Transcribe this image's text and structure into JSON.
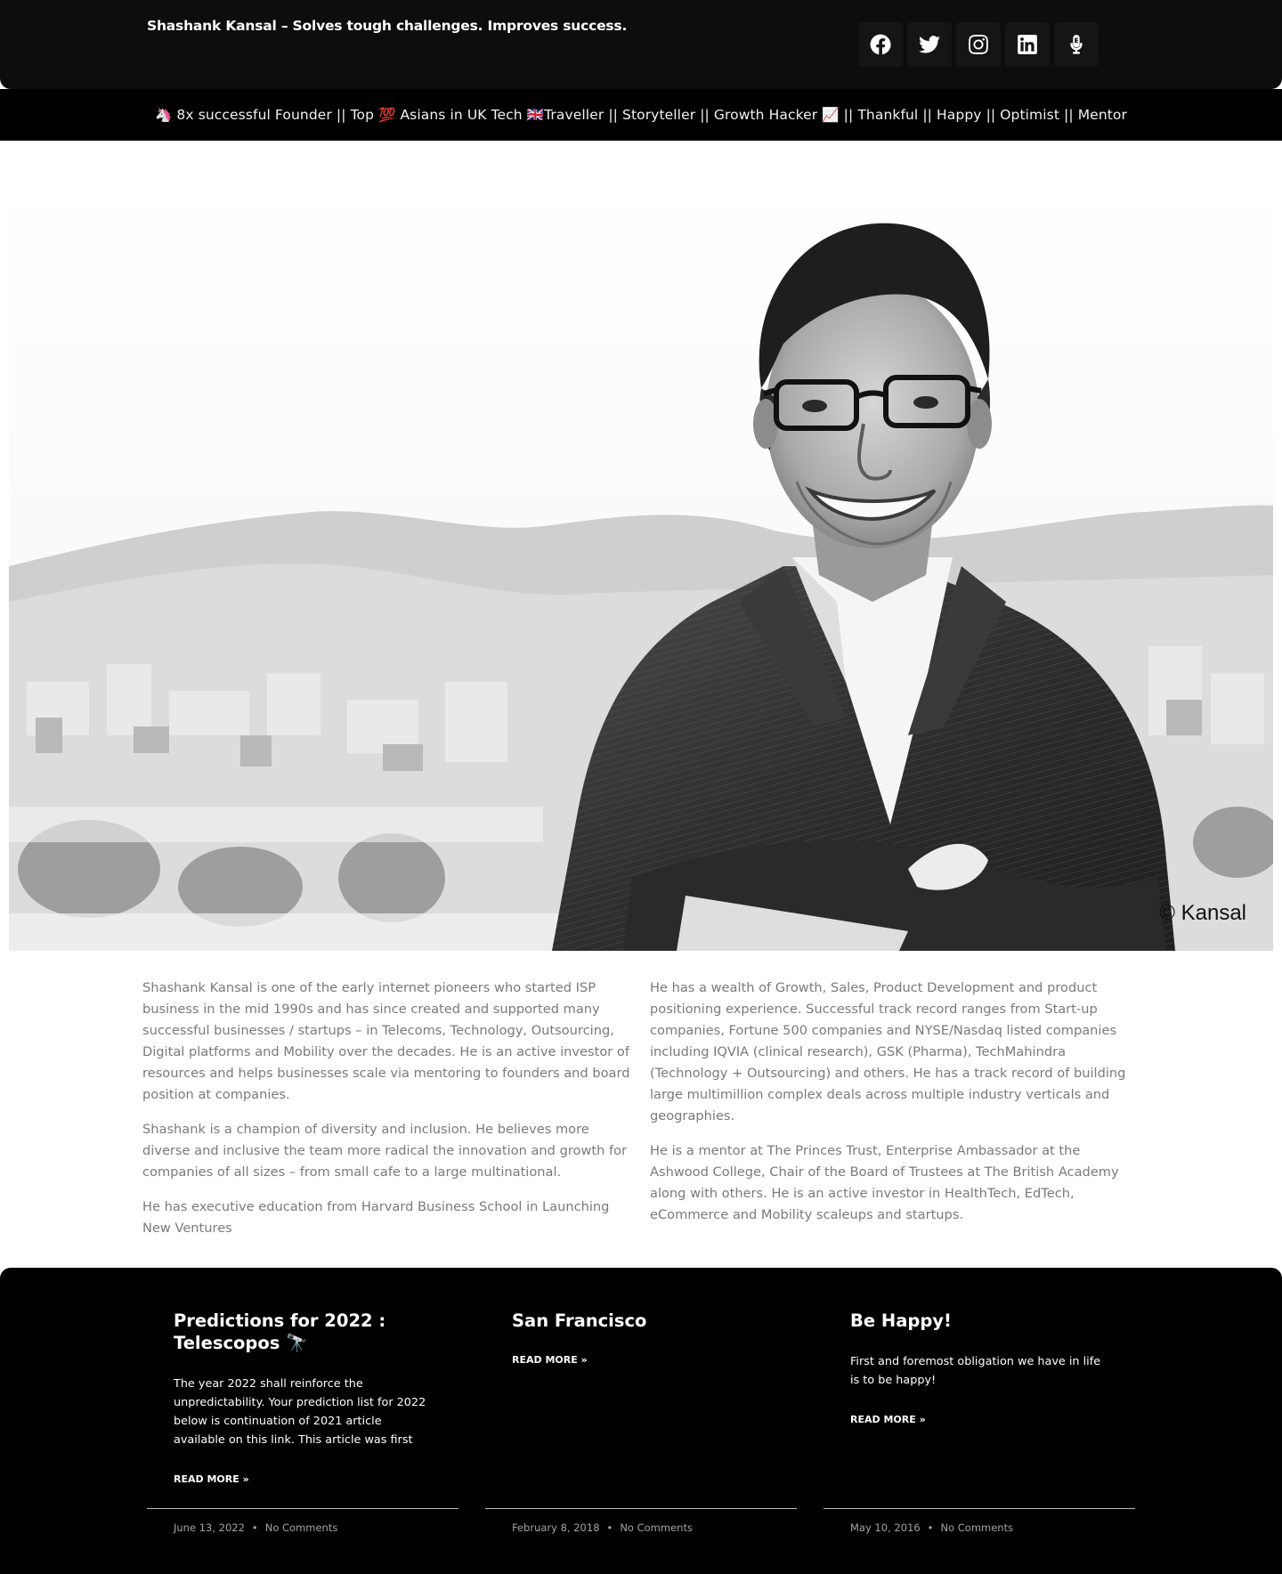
{
  "header": {
    "site_title": "Shashank Kansal – Solves tough challenges. Improves success.",
    "socials": [
      {
        "icon": "facebook-icon"
      },
      {
        "icon": "twitter-icon"
      },
      {
        "icon": "instagram-icon"
      },
      {
        "icon": "linkedin-icon"
      },
      {
        "icon": "microphone-icon"
      }
    ]
  },
  "tagline": "🦄 8x successful Founder || Top 💯 Asians in UK Tech 🇬🇧Traveller ||  Storyteller ||  Growth Hacker 📈 || Thankful  || Happy || Optimist || Mentor",
  "hero": {
    "copyright": "© Kansal"
  },
  "about": {
    "left": [
      "Shashank Kansal is one of the early internet pioneers who started ISP business in the mid 1990s and has since created and supported many successful businesses / startups – in Telecoms, Technology, Outsourcing, Digital platforms and Mobility over the decades. He is an active investor of resources and helps businesses scale via mentoring to founders and board position at companies.",
      "Shashank is a champion of diversity and inclusion. He believes more diverse and inclusive the team more radical the innovation and growth for companies of all sizes – from small cafe to a large multinational.",
      "He has executive education from Harvard Business School in Launching New Ventures"
    ],
    "right": [
      "He has a wealth of Growth, Sales, Product Development and product positioning experience. Successful track record ranges from Start-up companies, Fortune 500 companies and NYSE/Nasdaq listed companies including IQVIA (clinical research), GSK (Pharma), TechMahindra (Technology + Outsourcing) and others. He has a track record of building large multimillion complex deals across multiple industry verticals and geographies.",
      "He is a mentor at The Princes Trust, Enterprise Ambassador at the Ashwood College, Chair of the Board of Trustees at The British Academy along with others. He is an active investor in HealthTech, EdTech, eCommerce and Mobility scaleups and startups."
    ]
  },
  "posts": [
    {
      "title": "Predictions for 2022 : Telescopos 🔭",
      "excerpt": "The year 2022 shall reinforce the unpredictability. Your prediction list for 2022 below is continuation of 2021 article available on this link.  This article was first",
      "read_more": "READ MORE »",
      "date": "June 13, 2022",
      "comments": "No Comments"
    },
    {
      "title": "San Francisco",
      "excerpt": "",
      "read_more": "READ MORE »",
      "date": "February 8, 2018",
      "comments": "No Comments"
    },
    {
      "title": "Be Happy!",
      "excerpt": "First and foremost obligation we have in life is to be happy!",
      "read_more": "READ MORE »",
      "date": "May 10, 2016",
      "comments": "No Comments"
    }
  ],
  "meta_separator": "•",
  "colors": {
    "header_bg": "#0d0d0d",
    "tagline_bg": "#000000",
    "body_text": "#7a7a7a",
    "posts_bg": "#000000"
  }
}
